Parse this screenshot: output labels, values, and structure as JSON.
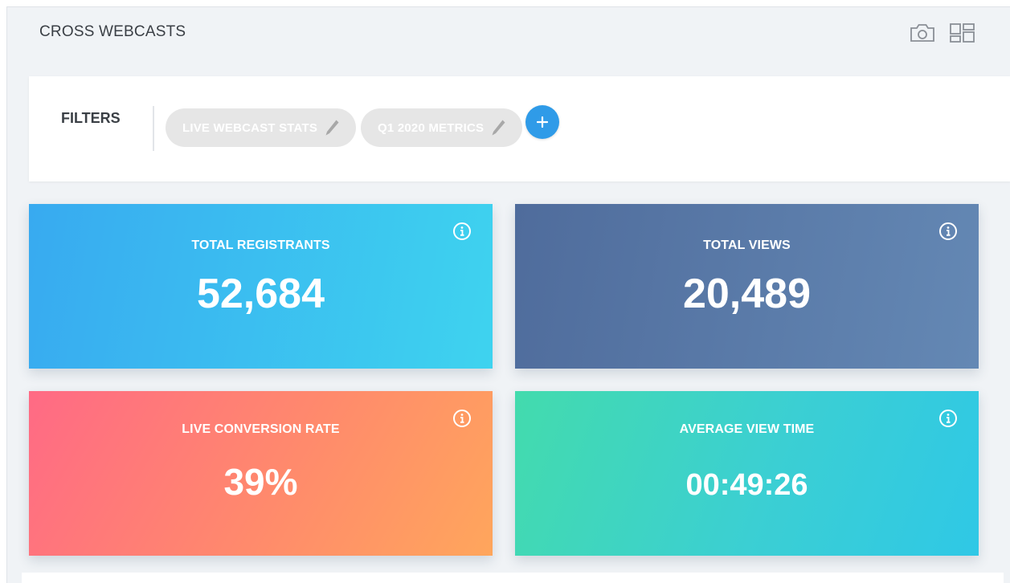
{
  "header": {
    "title": "CROSS WEBCASTS",
    "actions": [
      {
        "icon": "camera-icon"
      },
      {
        "icon": "dashboard-layout-icon"
      }
    ]
  },
  "filters": {
    "label": "FILTERS",
    "chips": [
      {
        "label": "LIVE WEBCAST STATS",
        "icon": "pencil-icon"
      },
      {
        "label": "Q1 2020 METRICS",
        "icon": "pencil-icon"
      }
    ],
    "add_label": "+"
  },
  "stats": [
    {
      "title": "TOTAL REGISTRANTS",
      "value": "52,684",
      "icon": "info-icon"
    },
    {
      "title": "TOTAL VIEWS",
      "value": "20,489",
      "icon": "info-icon"
    },
    {
      "title": "LIVE CONVERSION RATE",
      "value": "39%",
      "icon": "info-icon"
    },
    {
      "title": "AVERAGE VIEW TIME",
      "value": "00:49:26",
      "icon": "info-icon"
    }
  ],
  "colors": {
    "registrants_card": "#38aaf0",
    "views_card": "#5673a2",
    "conversion_card": "#ff6a85",
    "view_time_card": "#43dbad",
    "add_button": "#2f9be8",
    "chip_bg": "#e6e6e6"
  }
}
